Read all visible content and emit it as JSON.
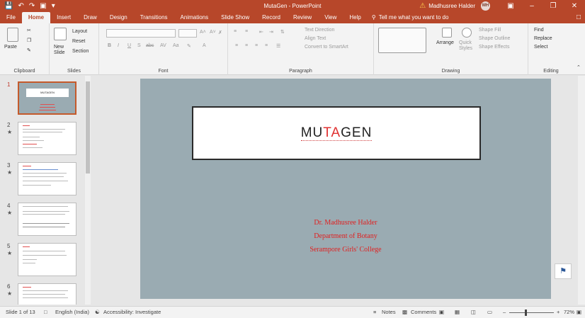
{
  "window": {
    "title": "MutaGen - PowerPoint",
    "user": "Madhusree Halder",
    "avatar": "MH",
    "qat_icons": [
      "save-icon",
      "undo-icon",
      "redo-icon",
      "start-slideshow-icon",
      "customize-icon"
    ]
  },
  "tabs": [
    "File",
    "Home",
    "Insert",
    "Draw",
    "Design",
    "Transitions",
    "Animations",
    "Slide Show",
    "Record",
    "Review",
    "View",
    "Help"
  ],
  "active_tab": "Home",
  "tell_me": "Tell me what you want to do",
  "ribbon": {
    "clipboard": {
      "paste": "Paste",
      "label": "Clipboard"
    },
    "slides": {
      "new_slide": "New Slide",
      "layout": "Layout",
      "reset": "Reset",
      "section": "Section",
      "label": "Slides"
    },
    "font": {
      "label": "Font"
    },
    "paragraph": {
      "text_direction": "Text Direction",
      "align_text": "Align Text",
      "convert_smartart": "Convert to SmartArt",
      "label": "Paragraph"
    },
    "drawing": {
      "arrange": "Arrange",
      "quick_styles": "Quick Styles",
      "shape_fill": "Shape Fill",
      "shape_outline": "Shape Outline",
      "shape_effects": "Shape Effects",
      "label": "Drawing"
    },
    "editing": {
      "find": "Find",
      "replace": "Replace",
      "select": "Select",
      "label": "Editing"
    }
  },
  "thumbnails": [
    "1",
    "2",
    "3",
    "4",
    "5",
    "6"
  ],
  "slide": {
    "title_left": "MU",
    "title_mid": "TA",
    "title_right": "GEN",
    "lines": [
      "Dr. Madhusree Halder",
      "Department of Botany",
      "Serampore Girls' College"
    ]
  },
  "thumb1": {
    "title": "MUTAGEN"
  },
  "status": {
    "slide_count": "Slide 1 of 13",
    "language": "English (India)",
    "accessibility": "Accessibility: Investigate",
    "notes": "Notes",
    "comments": "Comments",
    "zoom": "72%"
  }
}
